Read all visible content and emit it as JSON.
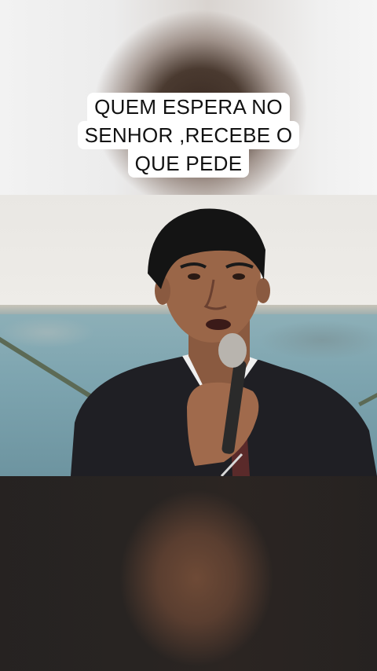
{
  "caption": {
    "lines": [
      "QUEM ESPERA NO",
      "SENHOR ,RECEBE O",
      "QUE PEDE"
    ]
  },
  "colors": {
    "caption_bg": "#ffffff",
    "caption_text": "#111111",
    "wall": "#7ea5b0"
  },
  "video": {
    "subject": "man in dark suit singing into microphone"
  }
}
